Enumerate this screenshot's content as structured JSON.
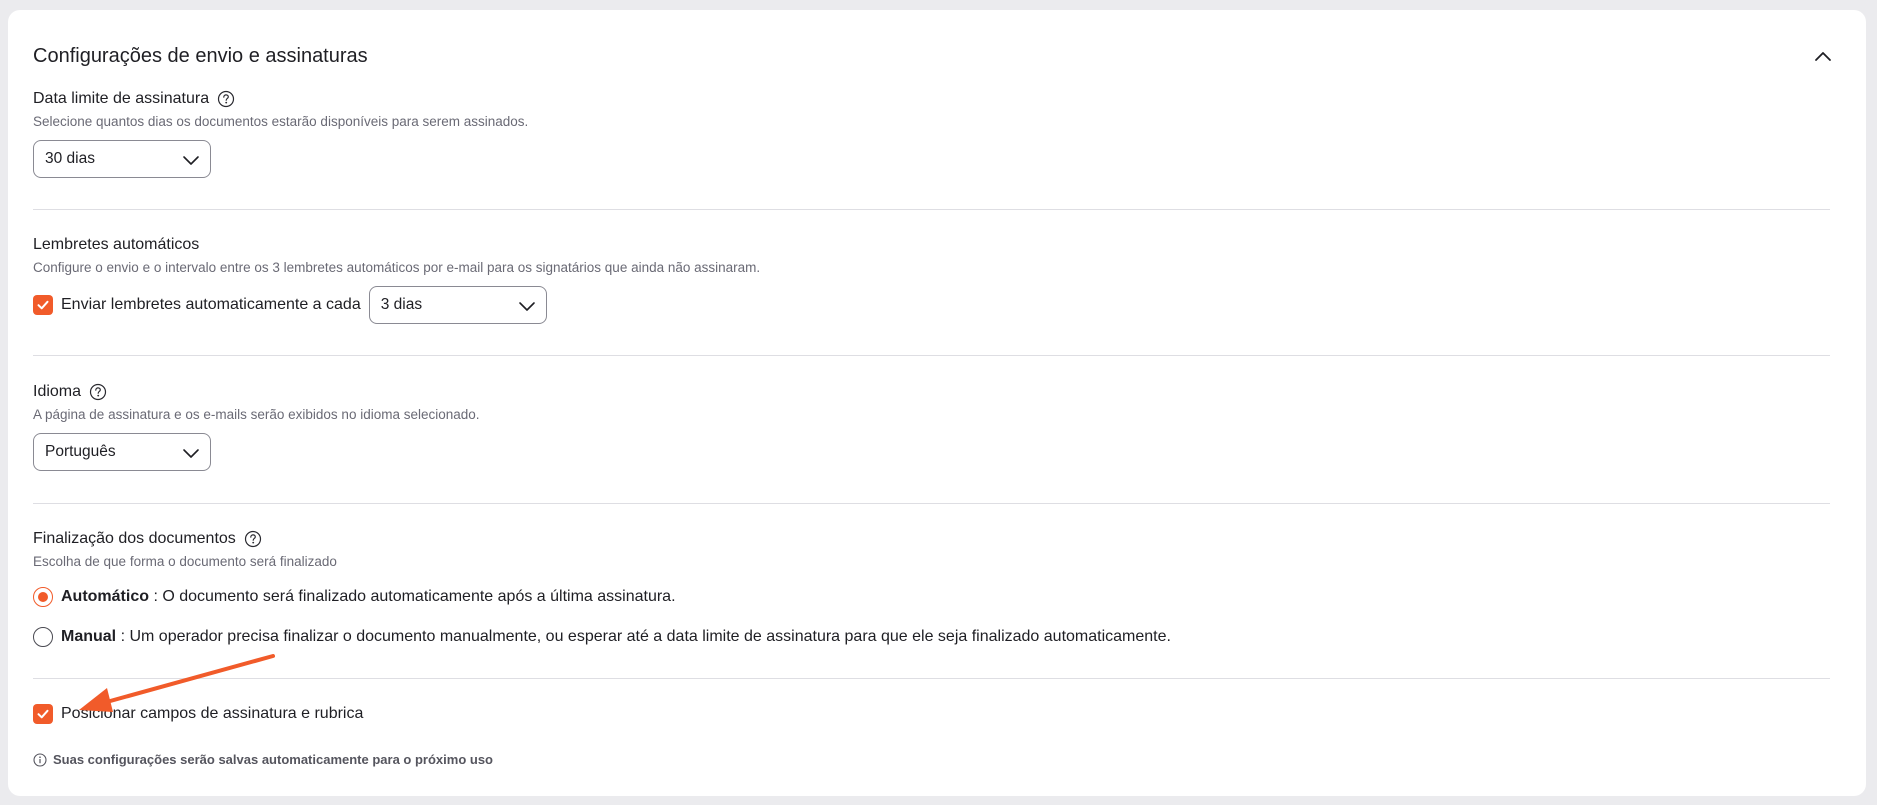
{
  "header": {
    "title": "Configurações de envio e assinaturas"
  },
  "deadline": {
    "label": "Data limite de assinatura",
    "description": "Selecione quantos dias os documentos estarão disponíveis para serem assinados.",
    "selected": "30 dias"
  },
  "reminders": {
    "label": "Lembretes automáticos",
    "description": "Configure o envio e o intervalo entre os 3 lembretes automáticos por e-mail para os signatários que ainda não assinaram.",
    "checkbox_label": "Enviar lembretes automaticamente a cada",
    "checked": true,
    "selected": "3 dias"
  },
  "language": {
    "label": "Idioma",
    "description": "A página de assinatura e os e-mails serão exibidos no idioma selecionado.",
    "selected": "Português"
  },
  "finalization": {
    "label": "Finalização dos documentos",
    "description": "Escolha de que forma o documento será finalizado",
    "options": [
      {
        "name": "Automático",
        "text": ": O documento será finalizado automaticamente após a última assinatura.",
        "selected": true
      },
      {
        "name": "Manual",
        "text": ": Um operador precisa finalizar o documento manualmente, ou esperar até a data limite de assinatura para que ele seja finalizado automaticamente.",
        "selected": false
      }
    ]
  },
  "position_fields": {
    "label": "Posicionar campos de assinatura e rubrica",
    "checked": true
  },
  "footer_note": "Suas configurações serão salvas automaticamente para o próximo uso",
  "colors": {
    "accent": "#f15b2a",
    "text": "#1f1f24",
    "muted": "#6a6a75",
    "divider": "#dedee3"
  },
  "icons": [
    "chevron-up-icon",
    "help-circle-icon",
    "chevron-down-icon",
    "checkmark-icon",
    "info-icon",
    "arrow-annotation"
  ]
}
